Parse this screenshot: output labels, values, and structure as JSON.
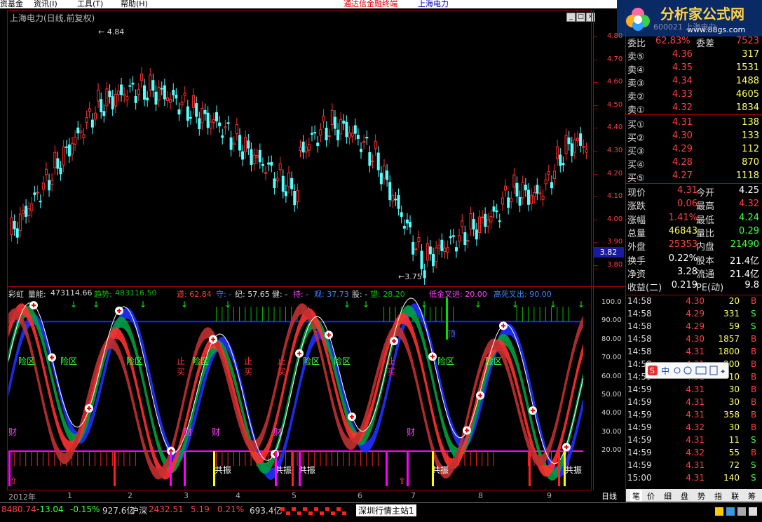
{
  "menubar": {
    "items": [
      "资基金",
      "资讯(I)",
      "工具(T)",
      "帮助(H)"
    ],
    "app_name": "通达信金融终端",
    "stock_name": "上海电力"
  },
  "chart_title": "上海电力(日线,前复权)",
  "price_labels": {
    "high": "4.84",
    "low": "3.75",
    "current": "3.82"
  },
  "price_axis": [
    "4.80",
    "4.70",
    "4.60",
    "4.50",
    "4.40",
    "4.30",
    "4.20",
    "4.10",
    "4.00",
    "3.90",
    "3.80"
  ],
  "indicator_axis": [
    "100.0",
    "90.00",
    "80.00",
    "70.00",
    "60.00",
    "50.00",
    "40.00",
    "30.00",
    "20.00"
  ],
  "indicator": {
    "name": "彩虹",
    "liangneng_label": "量能:",
    "liangneng_value": "473114.66",
    "qushi_label": "趋势:",
    "qushi_value": "483116.50",
    "dao": "道: 62.84",
    "shou": "守: -",
    "ji": "纪: 57.65",
    "jian": "健: -",
    "zhi": "持: -",
    "guan": "观: 37.73",
    "gu": "股: -",
    "wang": "望: 28.20",
    "dijin": "低金叉进: 20.00",
    "gaosi": "高死叉出: 90.00"
  },
  "chart_annotations": {
    "danger": "险区",
    "stop": "止",
    "buy": "买",
    "wealth": "财",
    "resonance": "共振",
    "top": "顶",
    "low_point": "底"
  },
  "x_axis": [
    "2012年",
    "1",
    "2",
    "3",
    "4",
    "5",
    "6",
    "7",
    "8",
    "9"
  ],
  "period_label": "日线",
  "logo": {
    "text": "分析家公式网",
    "url": "www.88gs.com"
  },
  "quote_header_partial": "600021 上海电力",
  "ask": [
    {
      "label": "卖⑤",
      "price": "4.36",
      "vol": "317"
    },
    {
      "label": "卖④",
      "price": "4.35",
      "vol": "1531"
    },
    {
      "label": "卖③",
      "price": "4.34",
      "vol": "1488"
    },
    {
      "label": "卖②",
      "price": "4.33",
      "vol": "4605"
    },
    {
      "label": "卖①",
      "price": "4.32",
      "vol": "1834"
    }
  ],
  "bid": [
    {
      "label": "买①",
      "price": "4.31",
      "vol": "138"
    },
    {
      "label": "买②",
      "price": "4.30",
      "vol": "133"
    },
    {
      "label": "买③",
      "price": "4.29",
      "vol": "112"
    },
    {
      "label": "买④",
      "price": "4.28",
      "vol": "870"
    },
    {
      "label": "买⑤",
      "price": "4.27",
      "vol": "1118"
    }
  ],
  "stats": [
    {
      "l1": "现价",
      "v1": "4.31",
      "l2": "今开",
      "v2": "4.25",
      "c1": "#ff4040",
      "c2": "#ffffff"
    },
    {
      "l1": "涨跌",
      "v1": "0.06",
      "l2": "最高",
      "v2": "4.32",
      "c1": "#ff4040",
      "c2": "#ff4040"
    },
    {
      "l1": "涨幅",
      "v1": "1.41%",
      "l2": "最低",
      "v2": "4.24",
      "c1": "#ff4040",
      "c2": "#40ff40"
    },
    {
      "l1": "总量",
      "v1": "46843",
      "l2": "量比",
      "v2": "0.29",
      "c1": "#ffff60",
      "c2": "#40ff40"
    },
    {
      "l1": "外盘",
      "v1": "25353",
      "l2": "内盘",
      "v2": "21490",
      "c1": "#ff4040",
      "c2": "#40ff40"
    },
    {
      "l1": "换手",
      "v1": "0.22%",
      "l2": "股本",
      "v2": "21.4亿",
      "c1": "#ffffff",
      "c2": "#ffffff"
    },
    {
      "l1": "净资",
      "v1": "3.28",
      "l2": "流通",
      "v2": "21.4亿",
      "c1": "#ffffff",
      "c2": "#ffffff"
    },
    {
      "l1": "收益(二)",
      "v1": "0.219",
      "l2": "PE(动)",
      "v2": "9.8",
      "c1": "#ffffff",
      "c2": "#ffffff"
    }
  ],
  "ask_top_partial": {
    "l1": "委比",
    "v1": "62.83%",
    "l2": "委差",
    "v2": "7523"
  },
  "trades": [
    {
      "t": "14:58",
      "p": "4.30",
      "v": "20",
      "s": "B"
    },
    {
      "t": "14:58",
      "p": "4.29",
      "v": "331",
      "s": "S"
    },
    {
      "t": "14:58",
      "p": "4.29",
      "v": "59",
      "s": "S"
    },
    {
      "t": "14:58",
      "p": "4.30",
      "v": "1857",
      "s": "B"
    },
    {
      "t": "14:58",
      "p": "4.31",
      "v": "1800",
      "s": "B"
    },
    {
      "t": "14:58",
      "p": "4.31",
      "v": "200",
      "s": "B"
    },
    {
      "t": "14:59",
      "p": "4.31",
      "v": "10",
      "s": "B"
    },
    {
      "t": "14:59",
      "p": "4.31",
      "v": "30",
      "s": "B"
    },
    {
      "t": "14:59",
      "p": "4.31",
      "v": "30",
      "s": "B"
    },
    {
      "t": "14:59",
      "p": "4.31",
      "v": "358",
      "s": "B"
    },
    {
      "t": "14:59",
      "p": "4.32",
      "v": "30",
      "s": "B"
    },
    {
      "t": "14:59",
      "p": "4.31",
      "v": "11",
      "s": "S"
    },
    {
      "t": "14:59",
      "p": "4.32",
      "v": "55",
      "s": "B"
    },
    {
      "t": "14:59",
      "p": "4.31",
      "v": "72",
      "s": "S"
    },
    {
      "t": "15:00",
      "p": "4.31",
      "v": "140",
      "s": "S"
    }
  ],
  "tabs": [
    "笔",
    "价",
    "细",
    "盘",
    "势",
    "指",
    "联",
    "筹"
  ],
  "status": {
    "sh_index": "8480.74",
    "sh_change": "-13.04",
    "sh_pct": "-0.15%",
    "sh_amount": "927.6亿",
    "sz_label": "沪深",
    "sz_index": "2432.51",
    "sz_change": "5.19",
    "sz_pct": "0.21%",
    "sz_amount": "693.4亿",
    "server": "深圳行情主站1"
  },
  "colors": {
    "up": "#ff3030",
    "down": "#54ffff",
    "bg": "#000000",
    "grid": "#aa0000",
    "green": "#00cc00",
    "magenta": "#ff00ff"
  }
}
